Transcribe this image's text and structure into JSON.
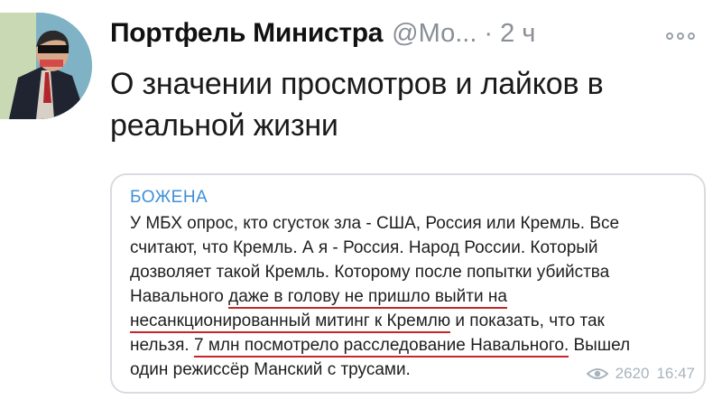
{
  "tweet": {
    "author_name": "Портфель Министра",
    "author_handle": "@Мо...",
    "separator": "·",
    "time": "2 ч",
    "text_line1": "О значении просмотров и лайков в",
    "text_line2": "реальной жизни"
  },
  "quote": {
    "sender": "БОЖЕНА",
    "line1": "У МБХ опрос, кто сгусток зла - США, Россия или Кремль. Все",
    "line2": "считают, что Кремль. А я - Россия. Народ России. Который",
    "line3": "дозволяет такой Кремль. Которому после попытки убийства",
    "line4_a": "Навального ",
    "line4_b": "даже в голову не пришло выйти на",
    "line5_a": "несанкционированный митинг к Кремлю",
    "line5_b": " и показать, что так",
    "line6_a": "нельзя. ",
    "line6_b": "7 млн посмотрело расследование Навального.",
    "line6_c": " Вышел",
    "line7": "один режиссёр Манский с трусами.",
    "views": "2620",
    "time": "16:47"
  },
  "colors": {
    "sender": "#3e8fd8",
    "underline": "#c8242b",
    "meta": "#a9b3bd",
    "handle": "#8a8f96"
  },
  "icons": {
    "more": "more-dots-icon",
    "views": "eye-icon"
  }
}
